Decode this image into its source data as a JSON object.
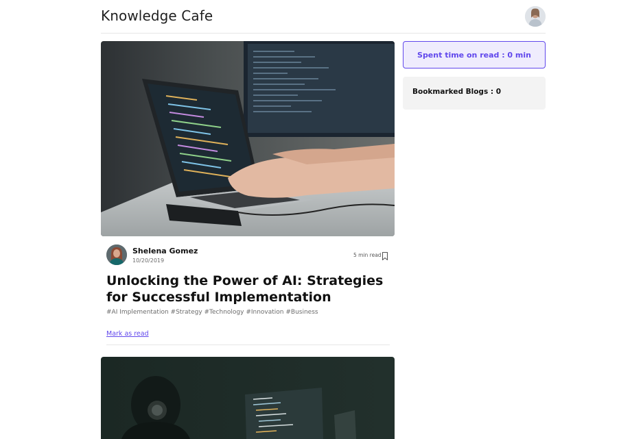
{
  "header": {
    "site_title": "Knowledge Cafe"
  },
  "posts": [
    {
      "cover_description": "laptop-coding-image",
      "author": {
        "name": "Shelena Gomez",
        "date": "10/20/2019"
      },
      "read_time": "5 min read",
      "title": "Unlocking the Power of AI: Strategies for Successful Implementation",
      "tags": "#AI Implementation #Strategy #Technology #Innovation #Business",
      "mark_as_read_label": "Mark as read"
    },
    {
      "cover_description": "dark-developer-image"
    }
  ],
  "sidebar": {
    "spent_time_text": "Spent time on read : 0 min",
    "bookmarked_text": "Bookmarked Blogs : 0"
  },
  "colors": {
    "accent": "#6047ec",
    "accent_bg": "#efecfd",
    "panel_bg": "#f3f3f3",
    "divider": "#e6e6e6"
  }
}
